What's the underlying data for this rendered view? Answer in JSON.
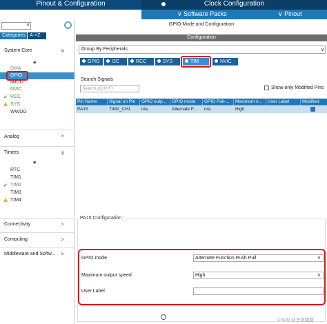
{
  "top_tabs": {
    "pinout": "Pinout & Configuration",
    "clock": "Clock Configuration"
  },
  "sub_menu": {
    "software_packs": "∨ Software Packs",
    "pinout": "∨ Pinout"
  },
  "left_panel": {
    "search_value": "",
    "search_dropdown": "∨",
    "tab_categories": "Categories",
    "tab_az": "A->Z",
    "system_core": {
      "label": "System Core",
      "expand": "∨",
      "sort": "◆",
      "items": [
        "DMA",
        "GPIO",
        "IWDG",
        "NVIC",
        "RCC",
        "SYS",
        "WWDG"
      ]
    },
    "analog": {
      "label": "Analog",
      "expand": ">"
    },
    "timers": {
      "label": "Timers",
      "expand": "∨",
      "sort": "◆",
      "items": [
        "RTC",
        "TIM1",
        "TIM2",
        "TIM3",
        "TIM4"
      ]
    },
    "connectivity": {
      "label": "Connectivity",
      "expand": ">"
    },
    "computing": {
      "label": "Computing",
      "expand": ">"
    },
    "middleware": {
      "label": "Middleware and Softw...",
      "expand": ">"
    }
  },
  "main": {
    "mode_title": "GPIO Mode and Configuration",
    "config_header": "Configuration",
    "group_by": "Group By Peripherals",
    "group_arrow": "∨",
    "peripheral_tabs": [
      "GPIO",
      "I2C",
      "RCC",
      "SYS",
      "TIM",
      "NVIC"
    ],
    "active_tab": "TIM",
    "search_signals_label": "Search Signals",
    "search_placeholder": "Search (Crtl+F)",
    "show_modified": "Show only Modified Pins",
    "table": {
      "headers": [
        "Pin Name",
        "Signal on Pin",
        "GPIO outp...",
        "GPIO mode",
        "GPIO Pull-...",
        "Maximum o...",
        "User Label",
        "Modified"
      ],
      "rows": [
        [
          "PA15",
          "TIM2_CH1",
          "n/a",
          "Alternate F...",
          "n/a",
          "High",
          "",
          ""
        ]
      ]
    },
    "pa15_title": "PA15 Configuration :",
    "params": {
      "gpio_mode_label": "GPIO mode",
      "gpio_mode_value": "Alternate Function Push Pull",
      "max_speed_label": "Maximum output speed",
      "max_speed_value": "High",
      "user_label_label": "User Label",
      "user_label_value": "",
      "arrow": "∨"
    }
  },
  "watermark": "CSDN @王凯旋旋",
  "colors": {
    "header_dark": "#0b4a7a",
    "accent_blue": "#1e78b8",
    "highlight_red": "#e01414",
    "selected_row": "#c9def0"
  }
}
